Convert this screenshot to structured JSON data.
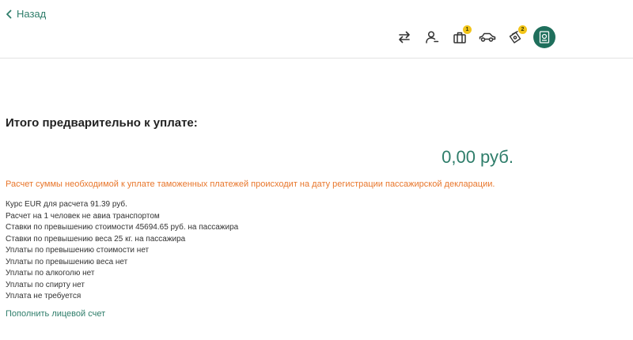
{
  "header": {
    "back_label": "Назад",
    "steps": [
      {
        "icon": "arrows-swap-icon",
        "badge": null
      },
      {
        "icon": "person-icon",
        "badge": null
      },
      {
        "icon": "luggage-icon",
        "badge": "1"
      },
      {
        "icon": "car-icon",
        "badge": null
      },
      {
        "icon": "money-icon",
        "badge": "2"
      },
      {
        "icon": "passport-icon",
        "badge": null,
        "active": true
      }
    ]
  },
  "summary": {
    "title": "Итого предварительно к уплате:",
    "amount": "0,00 руб.",
    "notice": "Расчет суммы необходимой к уплате таможенных платежей происходит на дату регистрации пассажирской декларации.",
    "details": [
      "Курс EUR для расчета 91.39 руб.",
      "Расчет на 1 человек не авиа транспортом",
      "Ставки по превышению стоимости 45694.65 руб. на пассажира",
      "Ставки по превышению веса 25 кг. на пассажира",
      "Уплаты по превышению стоимости нет",
      "Уплаты по превышению веса нет",
      "Уплаты по алкоголю нет",
      "Уплаты по спирту нет",
      "Уплата не требуется"
    ],
    "topup_link": "Пополнить лицевой счет"
  },
  "colors": {
    "accent": "#2e7d6a",
    "accent_dark": "#1f6f5c",
    "notice": "#e8762b",
    "badge": "#f2c51a"
  }
}
